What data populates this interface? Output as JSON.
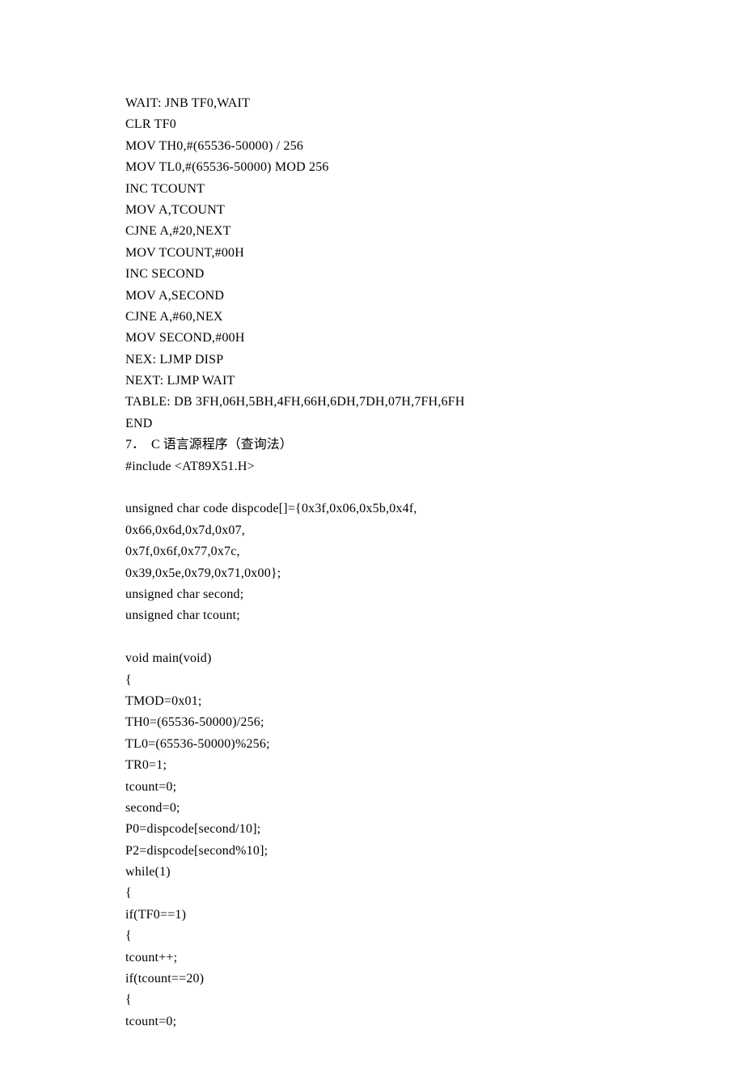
{
  "lines": [
    "WAIT: JNB TF0,WAIT",
    "CLR TF0",
    "MOV TH0,#(65536-50000) / 256",
    "MOV TL0,#(65536-50000) MOD 256",
    "INC TCOUNT",
    "MOV A,TCOUNT",
    "CJNE A,#20,NEXT",
    "MOV TCOUNT,#00H",
    "INC SECOND",
    "MOV A,SECOND",
    "CJNE A,#60,NEX",
    "MOV SECOND,#00H",
    "NEX: LJMP DISP",
    "NEXT: LJMP WAIT",
    "TABLE: DB 3FH,06H,5BH,4FH,66H,6DH,7DH,07H,7FH,6FH",
    "END"
  ],
  "sectionPrefix": "7．  C ",
  "sectionCjk": "语言源程序（查询法）",
  "cLines": [
    "#include <AT89X51.H>",
    "",
    "unsigned char code dispcode[]={0x3f,0x06,0x5b,0x4f,",
    "0x66,0x6d,0x7d,0x07,",
    "0x7f,0x6f,0x77,0x7c,",
    "0x39,0x5e,0x79,0x71,0x00};",
    "unsigned char second;",
    "unsigned char tcount;",
    "",
    "void main(void)",
    "{",
    "TMOD=0x01;",
    "TH0=(65536-50000)/256;",
    "TL0=(65536-50000)%256;",
    "TR0=1;",
    "tcount=0;",
    "second=0;",
    "P0=dispcode[second/10];",
    "P2=dispcode[second%10];",
    "while(1)",
    "{",
    "if(TF0==1)",
    "{",
    "tcount++;",
    "if(tcount==20)",
    "{",
    "tcount=0;"
  ]
}
